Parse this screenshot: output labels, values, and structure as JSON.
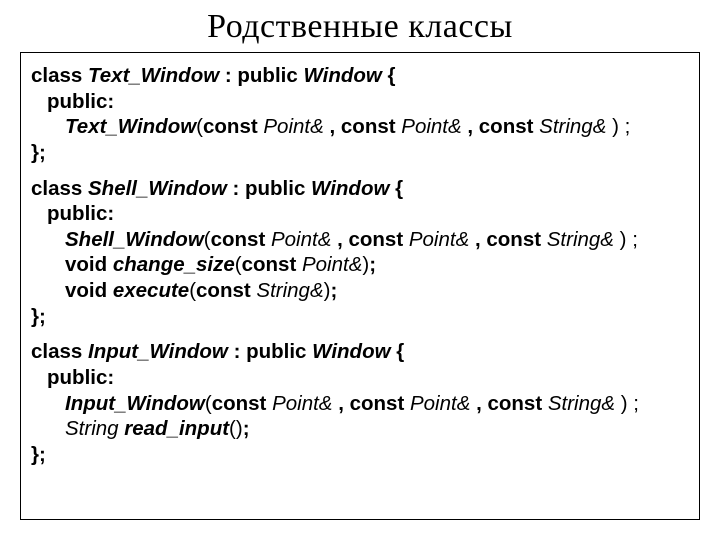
{
  "title": "Родственные классы",
  "cls": [
    {
      "decl": {
        "kw_class": "class ",
        "name": "Text_Window",
        "publicBase": " : public ",
        "base": "Window",
        "brace": " {"
      },
      "pub": "public:",
      "lines": [
        [
          {
            "t": "bi",
            "v": "Text_Window"
          },
          {
            "t": "n",
            "v": "("
          },
          {
            "t": "b",
            "v": "const "
          },
          {
            "t": "i",
            "v": "Point& "
          },
          {
            "t": "b",
            "v": ", "
          },
          {
            "t": "b",
            "v": "const "
          },
          {
            "t": "i",
            "v": "Point& "
          },
          {
            "t": "b",
            "v": ", "
          },
          {
            "t": "b",
            "v": "const "
          },
          {
            "t": "i",
            "v": "String& "
          },
          {
            "t": "n",
            "v": ") ;"
          }
        ]
      ],
      "close": "};"
    },
    {
      "decl": {
        "kw_class": "class ",
        "name": "Shell_Window",
        "publicBase": " : public ",
        "base": "Window",
        "brace": " {"
      },
      "pub": "public:",
      "lines": [
        [
          {
            "t": "bi",
            "v": "Shell_Window"
          },
          {
            "t": "n",
            "v": "("
          },
          {
            "t": "b",
            "v": "const "
          },
          {
            "t": "i",
            "v": "Point& "
          },
          {
            "t": "b",
            "v": ", "
          },
          {
            "t": "b",
            "v": "const "
          },
          {
            "t": "i",
            "v": "Point& "
          },
          {
            "t": "b",
            "v": ", "
          },
          {
            "t": "b",
            "v": "const "
          },
          {
            "t": "i",
            "v": "String& "
          },
          {
            "t": "n",
            "v": ") ;"
          }
        ],
        [
          {
            "t": "b",
            "v": "void "
          },
          {
            "t": "bi",
            "v": "change_size"
          },
          {
            "t": "n",
            "v": "("
          },
          {
            "t": "b",
            "v": "const "
          },
          {
            "t": "i",
            "v": "Point&"
          },
          {
            "t": "n",
            "v": ")"
          },
          {
            "t": "b",
            "v": ";"
          }
        ],
        [
          {
            "t": "b",
            "v": "void "
          },
          {
            "t": "bi",
            "v": "execute"
          },
          {
            "t": "n",
            "v": "("
          },
          {
            "t": "b",
            "v": "const "
          },
          {
            "t": "i",
            "v": "String&"
          },
          {
            "t": "n",
            "v": ")"
          },
          {
            "t": "b",
            "v": ";"
          }
        ]
      ],
      "close": "};"
    },
    {
      "decl": {
        "kw_class": "class ",
        "name": "Input_Window",
        "publicBase": " : public ",
        "base": "Window",
        "brace": " {"
      },
      "pub": "public:",
      "lines": [
        [
          {
            "t": "bi",
            "v": "Input_Window"
          },
          {
            "t": "n",
            "v": "("
          },
          {
            "t": "b",
            "v": "const "
          },
          {
            "t": "i",
            "v": "Point& "
          },
          {
            "t": "b",
            "v": ", "
          },
          {
            "t": "b",
            "v": "const "
          },
          {
            "t": "i",
            "v": "Point& "
          },
          {
            "t": "b",
            "v": ", "
          },
          {
            "t": "b",
            "v": "const "
          },
          {
            "t": "i",
            "v": "String& "
          },
          {
            "t": "n",
            "v": ") ;"
          }
        ],
        [
          {
            "t": "i",
            "v": "String  "
          },
          {
            "t": "bi",
            "v": "read_input"
          },
          {
            "t": "n",
            "v": "()"
          },
          {
            "t": "b",
            "v": ";"
          }
        ]
      ],
      "close": "};"
    }
  ]
}
